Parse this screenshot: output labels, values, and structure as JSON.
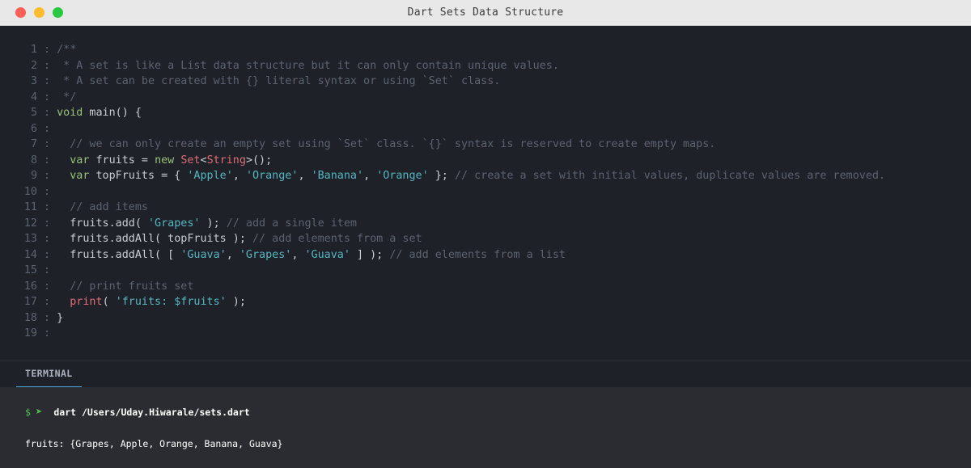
{
  "window": {
    "title": "Dart Sets Data Structure"
  },
  "colors": {
    "comment": "#5c6370",
    "keyword": "#98c379",
    "type": "#e06c75",
    "string": "#56b6c2",
    "plain": "#c8ccd4",
    "accent": "#4aa8e0",
    "prompt": "#4cc24c"
  },
  "editor": {
    "separator": ":",
    "lines": [
      {
        "n": "1",
        "tokens": [
          {
            "t": "/**",
            "k": "comment"
          }
        ]
      },
      {
        "n": "2",
        "tokens": [
          {
            "t": " * A set is like a List data structure but it can only contain unique values.",
            "k": "comment"
          }
        ]
      },
      {
        "n": "3",
        "tokens": [
          {
            "t": " * A set can be created with {} literal syntax or using `Set` class.",
            "k": "comment"
          }
        ]
      },
      {
        "n": "4",
        "tokens": [
          {
            "t": " */",
            "k": "comment"
          }
        ]
      },
      {
        "n": "5",
        "tokens": [
          {
            "t": "void",
            "k": "kw"
          },
          {
            "t": " main() {",
            "k": "plain"
          }
        ]
      },
      {
        "n": "6",
        "tokens": []
      },
      {
        "n": "7",
        "tokens": [
          {
            "t": "  // we can only create an empty set using `Set` class. `{}` syntax is reserved to create empty maps.",
            "k": "comment"
          }
        ]
      },
      {
        "n": "8",
        "tokens": [
          {
            "t": "  var",
            "k": "kw"
          },
          {
            "t": " fruits = ",
            "k": "plain"
          },
          {
            "t": "new",
            "k": "kw"
          },
          {
            "t": " ",
            "k": "plain"
          },
          {
            "t": "Set",
            "k": "type"
          },
          {
            "t": "<",
            "k": "plain"
          },
          {
            "t": "String",
            "k": "type"
          },
          {
            "t": ">();",
            "k": "plain"
          }
        ]
      },
      {
        "n": "9",
        "tokens": [
          {
            "t": "  var",
            "k": "kw"
          },
          {
            "t": " topFruits = { ",
            "k": "plain"
          },
          {
            "t": "'Apple'",
            "k": "str"
          },
          {
            "t": ", ",
            "k": "plain"
          },
          {
            "t": "'Orange'",
            "k": "str"
          },
          {
            "t": ", ",
            "k": "plain"
          },
          {
            "t": "'Banana'",
            "k": "str"
          },
          {
            "t": ", ",
            "k": "plain"
          },
          {
            "t": "'Orange'",
            "k": "str"
          },
          {
            "t": " }; ",
            "k": "plain"
          },
          {
            "t": "// create a set with initial values, duplicate values are removed.",
            "k": "comment"
          }
        ]
      },
      {
        "n": "10",
        "tokens": []
      },
      {
        "n": "11",
        "tokens": [
          {
            "t": "  // add items",
            "k": "comment"
          }
        ]
      },
      {
        "n": "12",
        "tokens": [
          {
            "t": "  fruits.add( ",
            "k": "plain"
          },
          {
            "t": "'Grapes'",
            "k": "str"
          },
          {
            "t": " ); ",
            "k": "plain"
          },
          {
            "t": "// add a single item",
            "k": "comment"
          }
        ]
      },
      {
        "n": "13",
        "tokens": [
          {
            "t": "  fruits.addAll( topFruits ); ",
            "k": "plain"
          },
          {
            "t": "// add elements from a set",
            "k": "comment"
          }
        ]
      },
      {
        "n": "14",
        "tokens": [
          {
            "t": "  fruits.addAll( [ ",
            "k": "plain"
          },
          {
            "t": "'Guava'",
            "k": "str"
          },
          {
            "t": ", ",
            "k": "plain"
          },
          {
            "t": "'Grapes'",
            "k": "str"
          },
          {
            "t": ", ",
            "k": "plain"
          },
          {
            "t": "'Guava'",
            "k": "str"
          },
          {
            "t": " ] ); ",
            "k": "plain"
          },
          {
            "t": "// add elements from a list",
            "k": "comment"
          }
        ]
      },
      {
        "n": "15",
        "tokens": []
      },
      {
        "n": "16",
        "tokens": [
          {
            "t": "  // print fruits set",
            "k": "comment"
          }
        ]
      },
      {
        "n": "17",
        "tokens": [
          {
            "t": "  ",
            "k": "plain"
          },
          {
            "t": "print",
            "k": "type"
          },
          {
            "t": "( ",
            "k": "plain"
          },
          {
            "t": "'fruits: $fruits'",
            "k": "str"
          },
          {
            "t": " );",
            "k": "plain"
          }
        ]
      },
      {
        "n": "18",
        "tokens": [
          {
            "t": "}",
            "k": "plain"
          }
        ]
      },
      {
        "n": "19",
        "tokens": []
      }
    ]
  },
  "panel": {
    "tab_label": "TERMINAL"
  },
  "terminal": {
    "prompt_symbol": "$",
    "arrow_icon": "➤",
    "command": "dart /Users/Uday.Hiwarale/sets.dart",
    "output": "fruits: {Grapes, Apple, Orange, Banana, Guava}"
  }
}
